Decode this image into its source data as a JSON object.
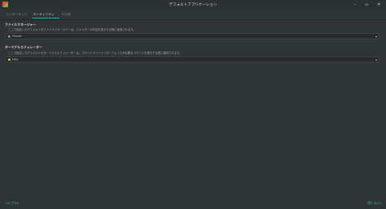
{
  "window": {
    "title": "デフォルトアプリケーション",
    "controls": {
      "minimize": "–",
      "maximize": "▫",
      "close": "✕"
    }
  },
  "tabs": [
    {
      "label": "インターネット",
      "active": false
    },
    {
      "label": "ユーティリティ",
      "active": true
    },
    {
      "label": "その他",
      "active": false
    }
  ],
  "file_manager": {
    "heading": "ファイルマネージャー",
    "description": "ここで指定したデフォルトのファイルマネージャーは、フォルダーの内容を表示する際に使用されます。",
    "selected": "Thunar",
    "icon": "folder-icon"
  },
  "terminal": {
    "heading": "ターミナルエミュレーター",
    "description": "ここで指定したデフォルトのターミナルエミュレーターは、コマンドラインインターフェイスが必要なコマンドを実行する際に使用されます。",
    "selected": "kitty",
    "icon": "terminal-icon"
  },
  "footer": {
    "help": "ヘルプ(H)",
    "close": "閉じる(C)"
  },
  "colors": {
    "accent": "#1db1a0",
    "background": "#2f3437",
    "link": "#39b7a5"
  }
}
